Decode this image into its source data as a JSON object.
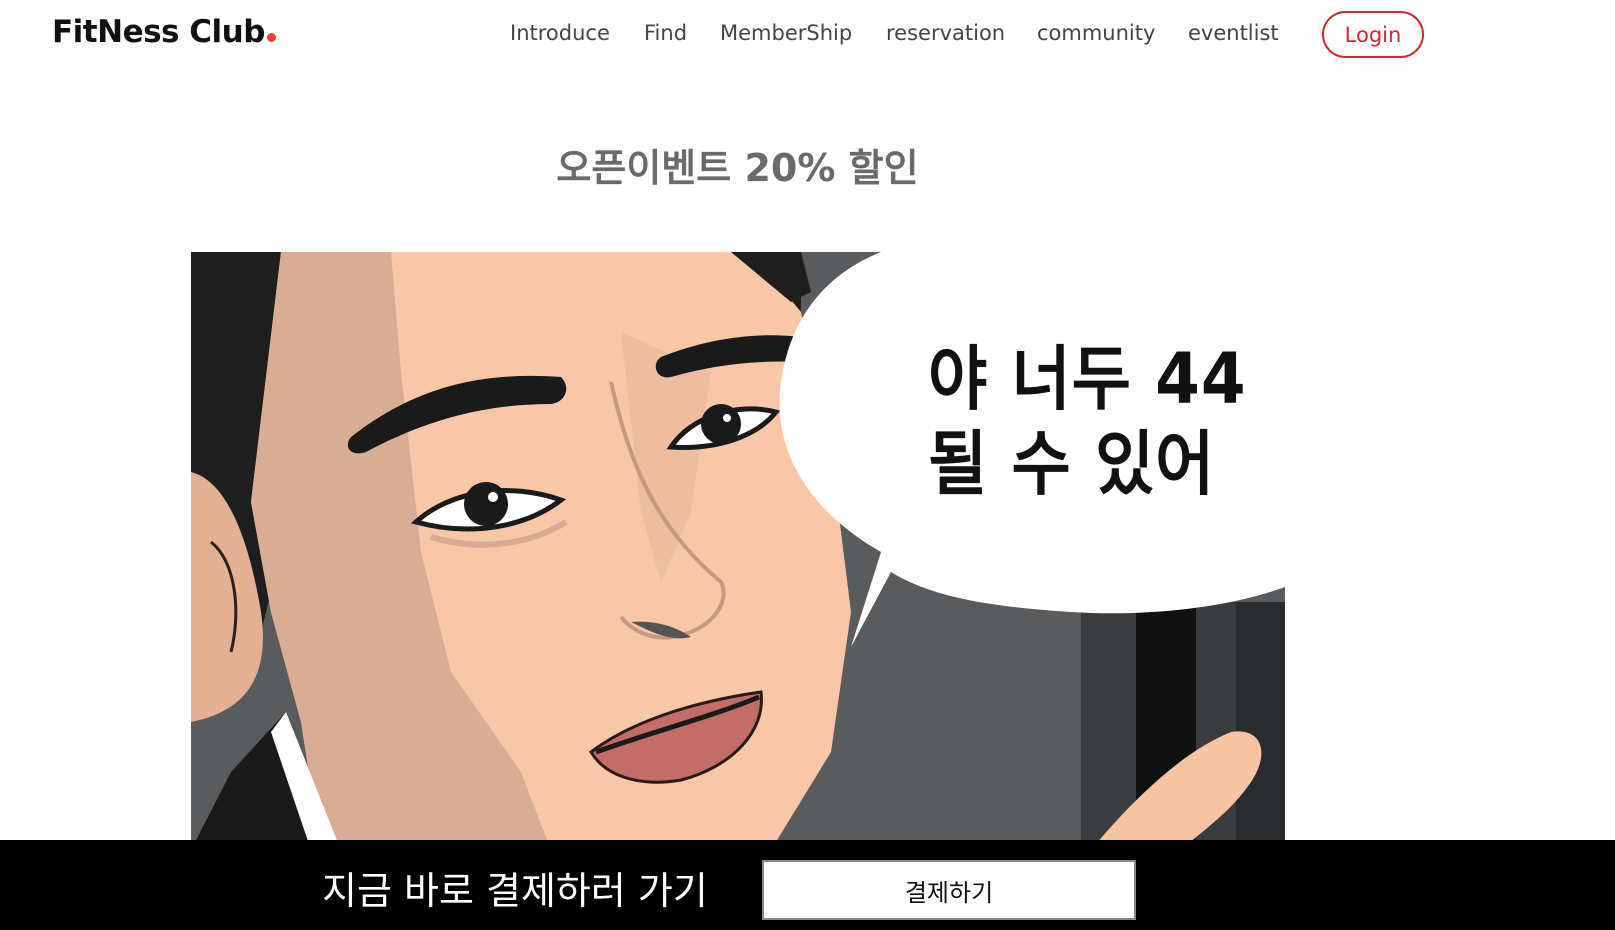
{
  "header": {
    "logo": "FitNess Club",
    "nav": [
      "Introduce",
      "Find",
      "MemberShip",
      "reservation",
      "community",
      "eventlist"
    ],
    "login_label": "Login"
  },
  "main": {
    "title": "오픈이벤트 20% 할인",
    "bubble_line1": "야 너두 44",
    "bubble_line2": "될 수 있어"
  },
  "footer_bar": {
    "text": "지금 바로 결제하러 가기",
    "button_label": "결제하기"
  },
  "colors": {
    "accent": "#d0282c",
    "logo_dot": "#e2453a",
    "bar": "#000000"
  }
}
